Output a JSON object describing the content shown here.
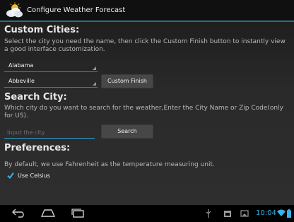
{
  "titlebar": {
    "title": "Configure Weather Forecast",
    "icon": "weather-cloud-sun-icon"
  },
  "custom_cities": {
    "heading": "Custom Cities:",
    "description": "Select the city you need the name, then click the Custom Finish button to instantly view a good interface customization.",
    "state_spinner": "Alabama",
    "city_spinner": "Abbeville",
    "finish_button": "Custom Finish"
  },
  "search_city": {
    "heading": "Search City:",
    "description": "Which city do you want to search for the weather,Enter the City Name or Zip Code(only for US).",
    "input_placeholder": "Input the city",
    "input_value": "",
    "search_button": "Search"
  },
  "preferences": {
    "heading": "Preferences:",
    "description": "By default, we use Fahrenheit as the temperature measuring unit.",
    "celsius_label": "Use Celsius",
    "celsius_checked": true
  },
  "navbar": {
    "clock": "10:04",
    "accent_color": "#36b3e8"
  }
}
